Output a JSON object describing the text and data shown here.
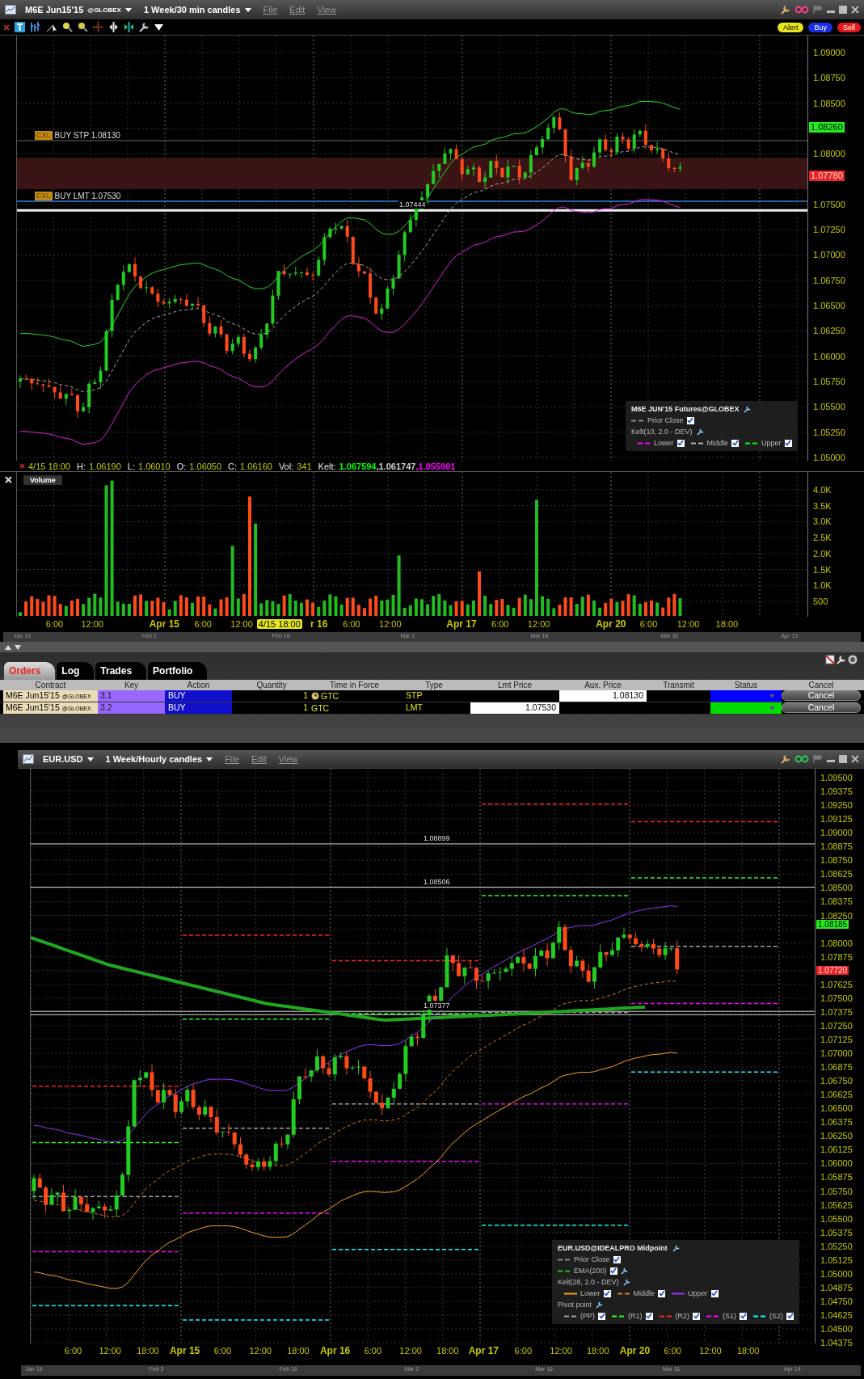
{
  "top_window": {
    "title": {
      "symbol": "M6E Jun15'15",
      "exchange": "@GLOBEX",
      "period": "1 Week/30 min candles"
    },
    "menu": [
      "File",
      "Edit",
      "View"
    ],
    "action_buttons": [
      {
        "label": "Alert",
        "kind": "alert"
      },
      {
        "label": "Buy",
        "kind": "buy"
      },
      {
        "label": "Sell",
        "kind": "sell"
      }
    ],
    "price_axis": [
      "1.09000",
      "1.08750",
      "1.08500",
      "1.08000",
      "1.07500",
      "1.07250",
      "1.07000",
      "1.06750",
      "1.06500",
      "1.06250",
      "1.06000",
      "1.05750",
      "1.05500",
      "1.05250",
      "1.05000"
    ],
    "price_tags": [
      {
        "text": "1.08260",
        "kind": "last"
      },
      {
        "text": "1.07780",
        "kind": "bid"
      }
    ],
    "order_lines": [
      {
        "tag": "CXL",
        "label": "BUY STP 1.08130",
        "kind": "stop"
      },
      {
        "tag": "CXL",
        "label": "BUY LMT 1.07530",
        "kind": "limit"
      }
    ],
    "line_label": "1.07444",
    "legend": {
      "title": "M6E JUN'15 Futures@GLOBEX",
      "sections": [
        {
          "items": [
            {
              "label": "Prior Close",
              "color": "#8a8a8a",
              "dashed": true,
              "checked": true
            }
          ]
        },
        {
          "label": "Kelt(10, 2.0 - DEV)",
          "items": [
            {
              "label": "Lower",
              "color": "#ff00ff",
              "dashed": true,
              "checked": true
            },
            {
              "label": "Middle",
              "color": "#b0b0b0",
              "dashed": true,
              "checked": true
            },
            {
              "label": "Upper",
              "color": "#00ff00",
              "dashed": true,
              "checked": true
            }
          ]
        }
      ]
    },
    "info_line": {
      "date": "4/15 18:00",
      "fields": [
        {
          "label": "H:",
          "value": "1.06190"
        },
        {
          "label": "L:",
          "value": "1.06010"
        },
        {
          "label": "O:",
          "value": "1.06050"
        },
        {
          "label": "C:",
          "value": "1.06160"
        },
        {
          "label": "Vol:",
          "value": "341"
        }
      ],
      "kelt_label": "Kelt:",
      "kelt_values": [
        {
          "text": "1.067594",
          "color": "#00ff00"
        },
        {
          "text": ",1.061747",
          "color": "#d0d0d0"
        },
        {
          "text": ",1.055901",
          "color": "#ff00ff"
        }
      ]
    },
    "volume_panel": {
      "title": "Volume",
      "axis": [
        "4.0K",
        "3.5K",
        "3.0K",
        "2.5K",
        "2.0K",
        "1.5K",
        "1.0K",
        "500"
      ]
    },
    "time_axis": [
      {
        "text": "6:00",
        "kind": "time"
      },
      {
        "text": "12:00",
        "kind": "time"
      },
      {
        "text": "Apr 15",
        "kind": "day"
      },
      {
        "text": "6:00",
        "kind": "time"
      },
      {
        "text": "12:00",
        "kind": "time"
      },
      {
        "text": "4/15 18:00",
        "kind": "cursor"
      },
      {
        "text": "r 16",
        "kind": "day"
      },
      {
        "text": "6:00",
        "kind": "time"
      },
      {
        "text": "12:00",
        "kind": "time"
      },
      {
        "text": "Apr 17",
        "kind": "day"
      },
      {
        "text": "6:00",
        "kind": "time"
      },
      {
        "text": "12:00",
        "kind": "time"
      },
      {
        "text": "Apr 20",
        "kind": "day"
      },
      {
        "text": "6:00",
        "kind": "time"
      },
      {
        "text": "12:00",
        "kind": "time"
      },
      {
        "text": "18:00",
        "kind": "time"
      }
    ],
    "scroll_dates": [
      "Jan 19",
      "Feb 2",
      "Feb 16",
      "Mar 2",
      "Mar 16",
      "Mar 30",
      "Apr 13"
    ]
  },
  "orders_panel": {
    "tabs": [
      {
        "label": "Orders",
        "selected": true
      },
      {
        "label": "Log",
        "selected": false
      },
      {
        "label": "Trades",
        "selected": false
      },
      {
        "label": "Portfolio",
        "selected": false
      }
    ],
    "columns": [
      "Contract",
      "Key",
      "Action",
      "Quantity",
      "Time in Force",
      "Type",
      "Lmt Price",
      "Aux. Price",
      "Transmit",
      "Status",
      "Cancel"
    ],
    "rows": [
      {
        "contract": "M6E Jun15'15",
        "exchange": "@GLOBEX",
        "key": "3.1",
        "action": "BUY",
        "quantity": "1",
        "tif_icon": true,
        "tif": "GTC",
        "type": "STP",
        "aux_price": "1.08130",
        "color": "#0000ff",
        "cancel": "Cancel"
      },
      {
        "contract": "M6E Jun15'15",
        "exchange": "@GLOBEX",
        "key": "3.2",
        "action": "BUY",
        "quantity": "1",
        "tif_icon": false,
        "tif": "GTC",
        "type": "LMT",
        "lmt_price": "1.07530",
        "color": "#00dd00",
        "cancel": "Cancel"
      }
    ]
  },
  "bottom_window": {
    "title": {
      "symbol": "EUR.USD",
      "period": "1 Week/Hourly candles"
    },
    "menu": [
      "File",
      "Edit",
      "View"
    ],
    "price_axis": [
      "1.09500",
      "1.09375",
      "1.09250",
      "1.09125",
      "1.09000",
      "1.08875",
      "1.08750",
      "1.08625",
      "1.08500",
      "1.08375",
      "1.08250",
      "1.08000",
      "1.07875",
      "1.07625",
      "1.07500",
      "1.07375",
      "1.07250",
      "1.07125",
      "1.07000",
      "1.06875",
      "1.06750",
      "1.06625",
      "1.06500",
      "1.06375",
      "1.06250",
      "1.06125",
      "1.06000",
      "1.05875",
      "1.05750",
      "1.05625",
      "1.05500",
      "1.05375",
      "1.05250",
      "1.05125",
      "1.05000",
      "1.04875",
      "1.04750",
      "1.04625",
      "1.04500",
      "1.04375"
    ],
    "price_tags": [
      {
        "text": "1.08185",
        "kind": "last"
      },
      {
        "text": "1.07720",
        "kind": "bid"
      }
    ],
    "level_labels": [
      "1.08899",
      "1.08506",
      "1.07377"
    ],
    "legend": {
      "title": "EUR.USD@IDEALPRO Midpoint",
      "sections": [
        {
          "items": [
            {
              "label": "Prior Close",
              "color": "#8a8a8a",
              "dashed": true,
              "checked": true
            }
          ]
        },
        {
          "items": [
            {
              "label": "EMA(200)",
              "color": "#22bb22",
              "dashed": true,
              "checked": true,
              "settings": true
            }
          ]
        },
        {
          "label": "Kelt(28, 2.0 - DEV)",
          "items": [
            {
              "label": "Lower",
              "color": "#ffa020",
              "dashed": false,
              "checked": true
            },
            {
              "label": "Middle",
              "color": "#e08020",
              "dashed": true,
              "checked": true
            },
            {
              "label": "Upper",
              "color": "#9933ff",
              "dashed": false,
              "checked": true
            }
          ]
        },
        {
          "label": "Pivot point",
          "items": [
            {
              "label": "(PP)",
              "color": "#a0a0a0",
              "dashed": true,
              "checked": true
            },
            {
              "label": "(R1)",
              "color": "#22ff22",
              "dashed": true,
              "checked": true
            },
            {
              "label": "(R2)",
              "color": "#ff2020",
              "dashed": true,
              "checked": true
            },
            {
              "label": "(S1)",
              "color": "#ff00ff",
              "dashed": true,
              "checked": true
            },
            {
              "label": "(S2)",
              "color": "#00ffff",
              "dashed": true,
              "checked": true
            }
          ]
        }
      ]
    },
    "time_axis": [
      {
        "text": "6:00",
        "kind": "time"
      },
      {
        "text": "12:00",
        "kind": "time"
      },
      {
        "text": "18:00",
        "kind": "time"
      },
      {
        "text": "Apr 15",
        "kind": "day"
      },
      {
        "text": "6:00",
        "kind": "time"
      },
      {
        "text": "12:00",
        "kind": "time"
      },
      {
        "text": "18:00",
        "kind": "time"
      },
      {
        "text": "Apr 16",
        "kind": "day"
      },
      {
        "text": "6:00",
        "kind": "time"
      },
      {
        "text": "12:00",
        "kind": "time"
      },
      {
        "text": "18:00",
        "kind": "time"
      },
      {
        "text": "Apr 17",
        "kind": "day"
      },
      {
        "text": "6:00",
        "kind": "time"
      },
      {
        "text": "12:00",
        "kind": "time"
      },
      {
        "text": "18:00",
        "kind": "time"
      },
      {
        "text": "Apr 20",
        "kind": "day"
      },
      {
        "text": "6:00",
        "kind": "time"
      },
      {
        "text": "12:00",
        "kind": "time"
      },
      {
        "text": "18:00",
        "kind": "time"
      }
    ],
    "scroll_dates": [
      "Jan 19",
      "Feb 2",
      "Feb 16",
      "Mar 2",
      "Mar 16",
      "Mar 31",
      "Apr 14"
    ]
  }
}
